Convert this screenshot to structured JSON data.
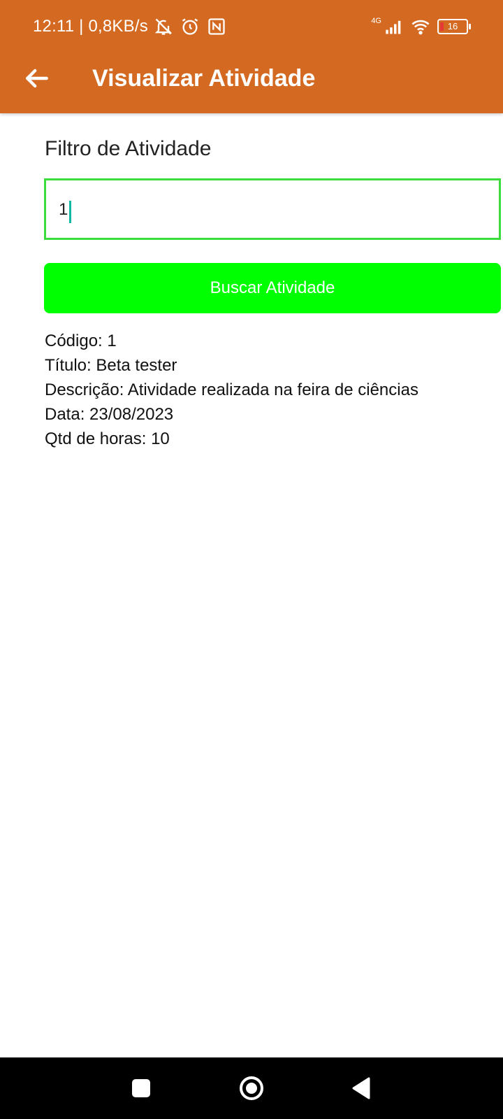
{
  "status_bar": {
    "time": "12:11 | 0,8KB/s",
    "network": "4G",
    "battery": "16",
    "icons": [
      "bell-off-icon",
      "alarm-icon",
      "nfc-icon",
      "signal-icon",
      "wifi-icon",
      "battery-icon"
    ]
  },
  "app_bar": {
    "title": "Visualizar Atividade",
    "back_icon": "arrow-left-icon",
    "color": "#d46a21"
  },
  "filter": {
    "label": "Filtro de Atividade",
    "value": "1",
    "border_color": "#3ddc3d"
  },
  "search_button": {
    "label": "Buscar Atividade",
    "color": "#00ff00"
  },
  "result": {
    "codigo": "Código: 1",
    "titulo": "Título: Beta tester",
    "descricao": "Descrição: Atividade realizada na feira de ciências",
    "data": "Data: 23/08/2023",
    "horas": "Qtd de horas: 10"
  },
  "nav_bar": {
    "buttons": [
      "recents-icon",
      "home-icon",
      "back-icon"
    ]
  }
}
